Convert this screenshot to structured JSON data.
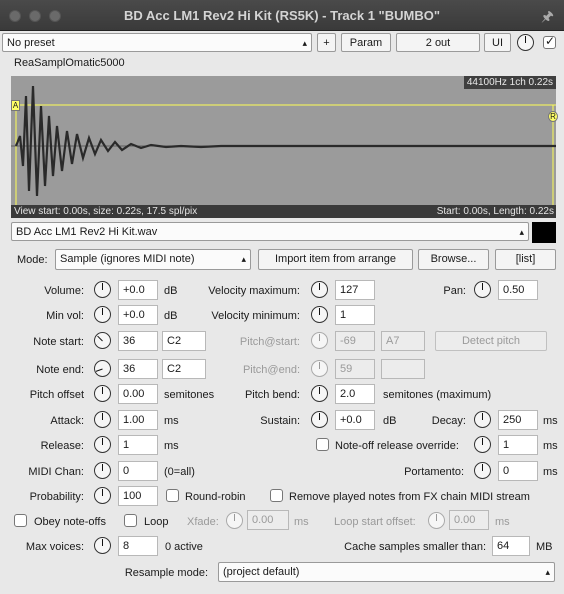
{
  "window": {
    "title": "BD Acc LM1 Rev2 Hi Kit (RS5K) - Track 1 \"BUMBO\""
  },
  "toolbar": {
    "preset": "No preset",
    "add_label": "+",
    "param_label": "Param",
    "io_label": "2 out",
    "ui_label": "UI"
  },
  "plugin_name": "ReaSamplOmatic5000",
  "waveform": {
    "info": "44100Hz 1ch 0.22s",
    "view_info": "View start: 0.00s, size: 0.22s, 17.5 spl/pix",
    "start_info": "Start: 0.00s, Length: 0.22s",
    "marker_a": "A",
    "marker_r": "R"
  },
  "file": {
    "name": "BD Acc LM1 Rev2 Hi Kit.wav"
  },
  "mode": {
    "label": "Mode:",
    "value": "Sample (ignores MIDI note)",
    "import_label": "Import item from arrange",
    "browse_label": "Browse...",
    "list_label": "[list]"
  },
  "params": {
    "volume": {
      "label": "Volume:",
      "value": "+0.0",
      "unit": "dB"
    },
    "min_vol": {
      "label": "Min vol:",
      "value": "+0.0",
      "unit": "dB"
    },
    "note_start": {
      "label": "Note start:",
      "value": "36",
      "note": "C2"
    },
    "note_end": {
      "label": "Note end:",
      "value": "36",
      "note": "C2"
    },
    "pitch_offset": {
      "label": "Pitch offset",
      "value": "0.00",
      "unit": "semitones"
    },
    "attack": {
      "label": "Attack:",
      "value": "1.00",
      "unit": "ms"
    },
    "release": {
      "label": "Release:",
      "value": "1",
      "unit": "ms"
    },
    "midi_chan": {
      "label": "MIDI Chan:",
      "value": "0",
      "note": "(0=all)"
    },
    "probability": {
      "label": "Probability:",
      "value": "100"
    },
    "round_robin": {
      "label": "Round-robin"
    },
    "vel_max": {
      "label": "Velocity maximum:",
      "value": "127"
    },
    "vel_min": {
      "label": "Velocity minimum:",
      "value": "1"
    },
    "pitch_start": {
      "label": "Pitch@start:",
      "value": "-69",
      "note": "A7"
    },
    "pitch_end": {
      "label": "Pitch@end:",
      "value": "59"
    },
    "detect_pitch": {
      "label": "Detect pitch"
    },
    "pitch_bend": {
      "label": "Pitch bend:",
      "value": "2.0",
      "unit": "semitones (maximum)"
    },
    "sustain": {
      "label": "Sustain:",
      "value": "+0.0",
      "unit": "dB"
    },
    "noteoff": {
      "label": "Note-off release override:",
      "value": "1",
      "unit": "ms"
    },
    "portamento": {
      "label": "Portamento:",
      "value": "0",
      "unit": "ms"
    },
    "remove_played": {
      "label": "Remove played notes from FX chain MIDI stream"
    },
    "pan": {
      "label": "Pan:",
      "value": "0.50"
    },
    "decay": {
      "label": "Decay:",
      "value": "250",
      "unit": "ms"
    },
    "obey_noteoffs": {
      "label": "Obey note-offs"
    },
    "loop": {
      "label": "Loop"
    },
    "xfade": {
      "label": "Xfade:",
      "value": "0.00",
      "unit": "ms"
    },
    "loop_start": {
      "label": "Loop start offset:",
      "value": "0.00",
      "unit": "ms"
    },
    "max_voices": {
      "label": "Max voices:",
      "value": "8",
      "note": "0 active"
    },
    "cache": {
      "label": "Cache samples smaller than:",
      "value": "64",
      "unit": "MB"
    },
    "resample": {
      "label": "Resample mode:",
      "value": "(project default)"
    }
  }
}
